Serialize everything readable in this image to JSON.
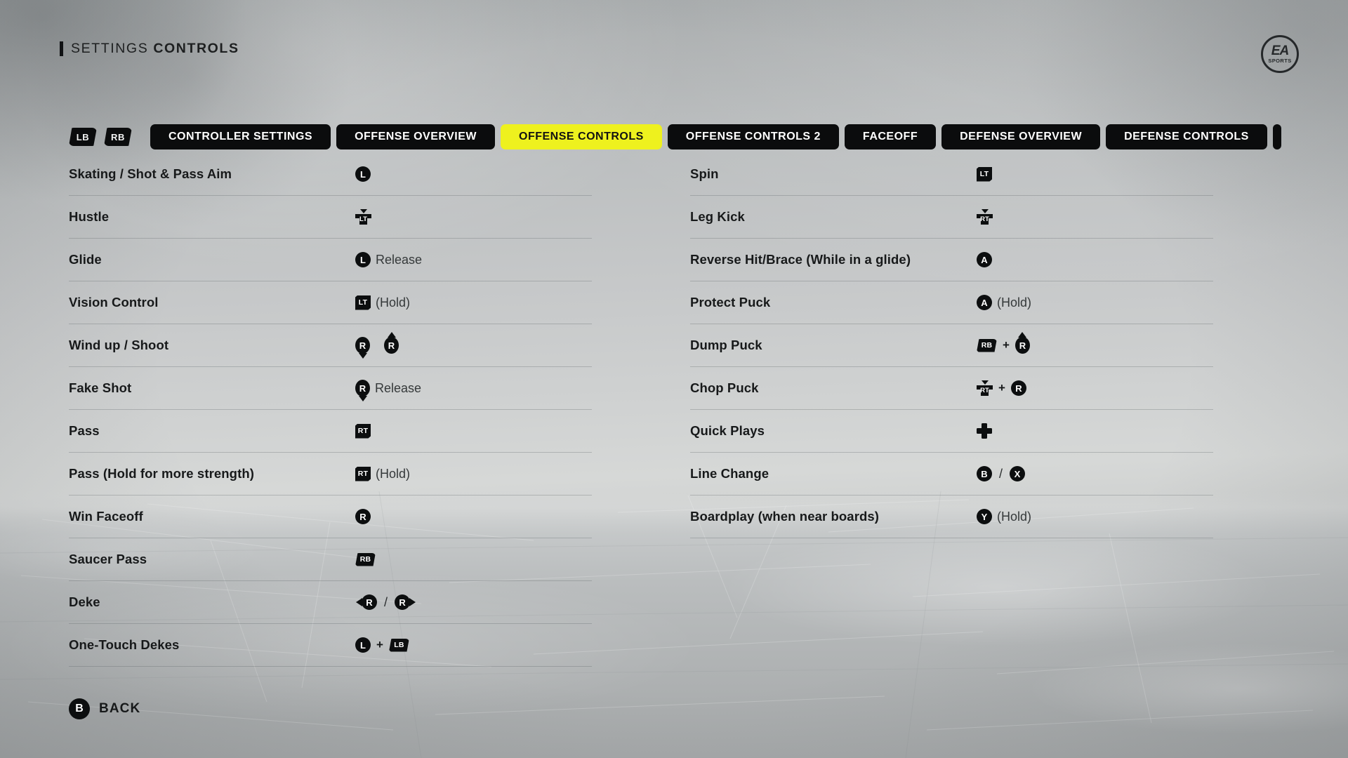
{
  "header": {
    "title_thin": "SETTINGS",
    "title_bold": "CONTROLS",
    "accent_color": "#111315"
  },
  "logo": {
    "ea_text": "EA",
    "sports_text": "SPORTS",
    "name": "ea-sports-logo"
  },
  "tabstrip": {
    "bumper_left": "LB",
    "bumper_right": "RB",
    "active_tab_color": "#eef11e",
    "tab_color": "#0b0c0d",
    "tabs": [
      {
        "label": "CONTROLLER SETTINGS",
        "active": false
      },
      {
        "label": "OFFENSE OVERVIEW",
        "active": false
      },
      {
        "label": "OFFENSE CONTROLS",
        "active": true
      },
      {
        "label": "OFFENSE CONTROLS 2",
        "active": false
      },
      {
        "label": "FACEOFF",
        "active": false
      },
      {
        "label": "DEFENSE OVERVIEW",
        "active": false
      },
      {
        "label": "DEFENSE CONTROLS",
        "active": false
      },
      {
        "label": "",
        "active": false
      }
    ]
  },
  "left_column": [
    {
      "label": "Skating / Shot & Pass Aim",
      "binding_text": "L"
    },
    {
      "label": "Hustle",
      "binding_text": "LT (press)"
    },
    {
      "label": "Glide",
      "binding_text": "L Release"
    },
    {
      "label": "Vision Control",
      "binding_text": "LT (Hold)",
      "suffix": "(Hold)"
    },
    {
      "label": "Wind up / Shoot",
      "binding_text": "R down, R up"
    },
    {
      "label": "Fake Shot",
      "binding_text": "R Release",
      "suffix": "Release"
    },
    {
      "label": "Pass",
      "binding_text": "RT"
    },
    {
      "label": "Pass (Hold for more strength)",
      "binding_text": "RT (Hold)",
      "suffix": "(Hold)"
    },
    {
      "label": "Win Faceoff",
      "binding_text": "R"
    },
    {
      "label": "Saucer Pass",
      "binding_text": "RB"
    },
    {
      "label": "Deke",
      "binding_text": "R left / R right"
    },
    {
      "label": "One-Touch Dekes",
      "binding_text": "L + LB"
    }
  ],
  "right_column": [
    {
      "label": "Spin",
      "binding_text": "LT"
    },
    {
      "label": "Leg Kick",
      "binding_text": "RT (press)"
    },
    {
      "label": "Reverse Hit/Brace (While in a glide)",
      "binding_text": "A"
    },
    {
      "label": "Protect Puck",
      "binding_text": "A (Hold)",
      "suffix": "(Hold)"
    },
    {
      "label": "Dump Puck",
      "binding_text": "RB + R up"
    },
    {
      "label": "Chop Puck",
      "binding_text": "RT (press) + R"
    },
    {
      "label": "Quick Plays",
      "binding_text": "D-Pad"
    },
    {
      "label": "Line Change",
      "binding_text": "B / X"
    },
    {
      "label": "Boardplay (when near boards)",
      "binding_text": "Y (Hold)",
      "suffix": "(Hold)"
    }
  ],
  "glyph_labels": {
    "left_stick": "L",
    "right_stick": "R",
    "left_trigger": "LT",
    "right_trigger": "RT",
    "left_bumper": "LB",
    "right_bumper": "RB",
    "a_button": "A",
    "b_button": "B",
    "x_button": "X",
    "y_button": "Y"
  },
  "words": {
    "release": "Release",
    "hold": "(Hold)",
    "plus": "+",
    "slash": "/"
  },
  "footer": {
    "back_button_glyph": "B",
    "back_label": "BACK"
  }
}
